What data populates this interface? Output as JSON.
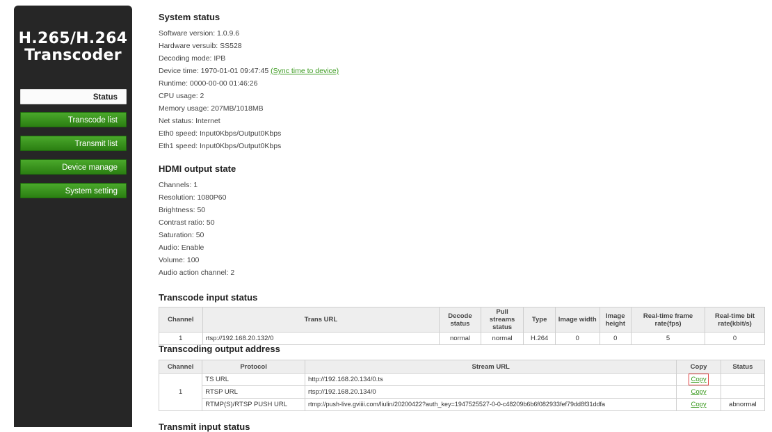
{
  "sidebar": {
    "title_line1": "H.265/H.264",
    "title_line2": "Transcoder",
    "items": [
      {
        "label": "Status"
      },
      {
        "label": "Transcode list"
      },
      {
        "label": "Transmit list"
      },
      {
        "label": "Device manage"
      },
      {
        "label": "System setting"
      }
    ]
  },
  "system_status": {
    "title": "System status",
    "lines": [
      "Software version: 1.0.9.6",
      "Hardware versuib: SS528",
      "Decoding mode: IPB",
      "Device time: 1970-01-01 09:47:45 ",
      "Runtime: 0000-00-00 01:46:26",
      "CPU usage: 2",
      "Memory usage: 207MB/1018MB",
      "Net status: Internet",
      "Eth0 speed: Input0Kbps/Output0Kbps",
      "Eth1 speed: Input0Kbps/Output0Kbps"
    ],
    "sync_link": "(Sync time to device)"
  },
  "hdmi": {
    "title": "HDMI output state",
    "lines": [
      "Channels: 1",
      "Resolution: 1080P60",
      "Brightness: 50",
      "Contrast ratio: 50",
      "Saturation: 50",
      "Audio: Enable",
      "Volume: 100",
      "Audio action channel: 2"
    ]
  },
  "transcode_input": {
    "title": "Transcode input status",
    "headers": [
      "Channel",
      "Trans URL",
      "Decode status",
      "Pull streams status",
      "Type",
      "Image width",
      "Image height",
      "Real-time frame rate(fps)",
      "Real-time bit rate(kbit/s)"
    ],
    "row": [
      "1",
      "rtsp://192.168.20.132/0",
      "normal",
      "normal",
      "H.264",
      "0",
      "0",
      "5",
      "0"
    ]
  },
  "transcoding_output": {
    "title": "Transcoding output address",
    "headers": [
      "Channel",
      "Protocol",
      "Stream URL",
      "Copy",
      "Status"
    ],
    "channel": "1",
    "rows": [
      {
        "protocol": "TS URL",
        "url": "http://192.168.20.134/0.ts",
        "copy": "Copy",
        "status": ""
      },
      {
        "protocol": "RTSP URL",
        "url": "rtsp://192.168.20.134/0",
        "copy": "Copy",
        "status": ""
      },
      {
        "protocol": "RTMP(S)/RTSP PUSH URL",
        "url": "rtmp://push-live.gviiii.com/liulin/20200422?auth_key=1947525527-0-0-c48209b6b6f082933fef79dd8f31ddfa",
        "copy": "Copy",
        "status": "abnormal"
      }
    ]
  },
  "next_section": {
    "title": "Transmit input status"
  }
}
